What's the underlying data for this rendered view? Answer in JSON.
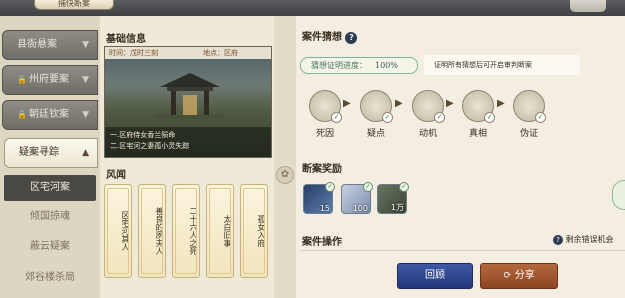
{
  "top_tab_label": "捕快断案",
  "sidebar": {
    "categories": [
      {
        "label": "县衙悬案",
        "locked": false
      },
      {
        "label": "州府要案",
        "locked": true
      },
      {
        "label": "朝廷钦案",
        "locked": true
      },
      {
        "label": "疑案寻踪",
        "locked": false,
        "active": true
      }
    ],
    "sub_items": [
      {
        "label": "区宅河案",
        "active": true
      },
      {
        "label": "倾国掠魂",
        "active": false
      },
      {
        "label": "蔽云疑案",
        "active": false
      },
      {
        "label": "郊谷楼杀局",
        "active": false
      }
    ]
  },
  "basic_info": {
    "title": "基础信息",
    "time_label": "时间：戊时三刻",
    "location_label": "地点：区府",
    "lines": [
      "一.区府侍女香兰殒命",
      "二.区宅河之妻孤小灵失踪"
    ]
  },
  "rumors": {
    "title": "风闻",
    "scrolls": [
      "区宅河其人",
      "善良的夙夫人",
      "二十六人之死",
      "太白旧事",
      "孤女入府"
    ]
  },
  "case_guess": {
    "title": "案件猜想",
    "help": "?",
    "progress_label": "猜想证明进度：",
    "progress_value": "100%",
    "progress_fraction": 1.0,
    "hint": "证明所有猜想后可开启审判断案",
    "steps": [
      "死因",
      "疑点",
      "动机",
      "真相",
      "伪证"
    ],
    "step_icons": [
      "body-icon",
      "clue-icon",
      "motive-icon",
      "truth-icon",
      "fake-evidence-icon"
    ]
  },
  "reward": {
    "title": "断案奖励",
    "items": [
      {
        "count": "15",
        "icon": "scroll-item-icon"
      },
      {
        "count": "100",
        "icon": "silver-item-icon"
      },
      {
        "count": "1万",
        "icon": "coin-item-icon"
      }
    ]
  },
  "operation": {
    "title": "案件操作",
    "warn": "剩余错误机会",
    "back_label": "回顾",
    "share_label": "分享"
  },
  "colors": {
    "back_button": "#2f4a96",
    "share_button": "#a55a30",
    "progress_border": "#7fb59d"
  }
}
